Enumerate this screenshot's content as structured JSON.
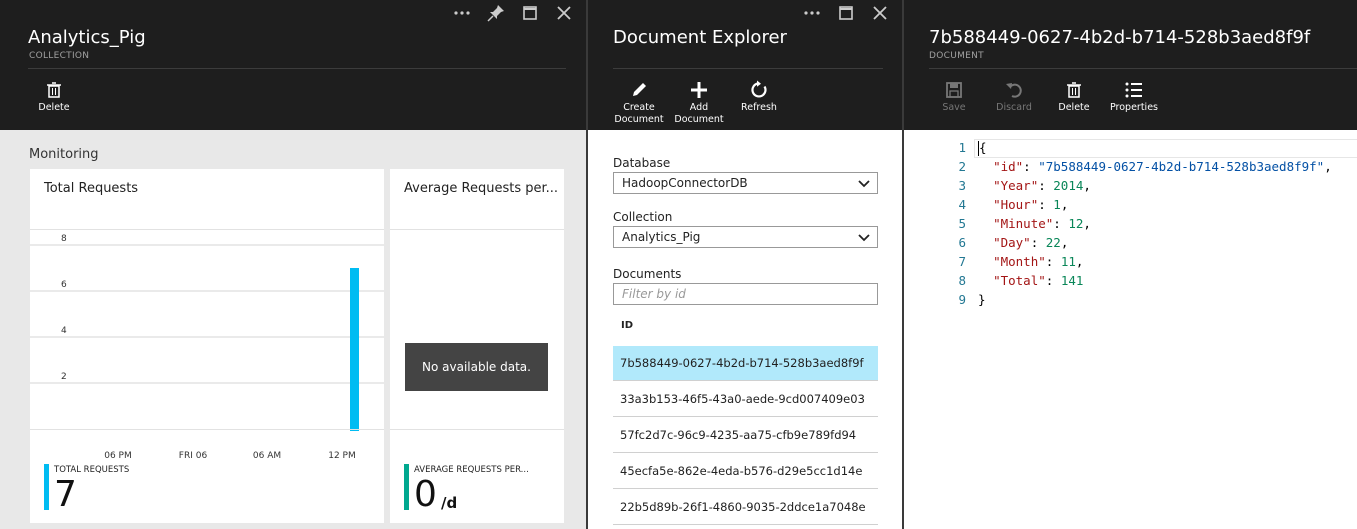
{
  "blade1": {
    "title": "Analytics_Pig",
    "subtitle": "COLLECTION",
    "commands": [
      {
        "label": "Delete",
        "icon": "trash-icon"
      }
    ],
    "section_title": "Monitoring",
    "tile_total": {
      "title": "Total Requests",
      "summary_label": "TOTAL REQUESTS",
      "summary_value": "7",
      "summary_color": "#00bcf2"
    },
    "tile_avg": {
      "title": "Average Requests per...",
      "no_data": "No available data.",
      "summary_label": "AVERAGE REQUESTS PER...",
      "summary_value": "0",
      "summary_unit": "/d",
      "summary_color": "#00a88f"
    }
  },
  "chart_data": {
    "type": "bar",
    "title": "Total Requests",
    "y_ticks": [
      "8",
      "6",
      "4",
      "2"
    ],
    "x_ticks": [
      "06 PM",
      "FRI 06",
      "06 AM",
      "12 PM"
    ],
    "ylim": [
      0,
      8
    ],
    "bars": [
      {
        "x": "12 PM",
        "value": 7
      }
    ],
    "bar_color": "#00bcf2",
    "grid": true
  },
  "blade2": {
    "title": "Document Explorer",
    "commands": [
      {
        "label": "Create Document",
        "icon": "pencil-icon"
      },
      {
        "label": "Add Document",
        "icon": "plus-icon"
      },
      {
        "label": "Refresh",
        "icon": "refresh-icon"
      }
    ],
    "database_label": "Database",
    "database_value": "HadoopConnectorDB",
    "collection_label": "Collection",
    "collection_value": "Analytics_Pig",
    "documents_label": "Documents",
    "filter_placeholder": "Filter by id",
    "id_header": "ID",
    "documents": [
      "7b588449-0627-4b2d-b714-528b3aed8f9f",
      "33a3b153-46f5-43a0-aede-9cd007409e03",
      "57fc2d7c-96c9-4235-aa75-cfb9e789fd94",
      "45ecfa5e-862e-4eda-b576-d29e5cc1d14e",
      "22b5d89b-26f1-4860-9035-2ddce1a7048e"
    ],
    "selected_index": 0
  },
  "blade3": {
    "title": "7b588449-0627-4b2d-b714-528b3aed8f9f",
    "subtitle": "DOCUMENT",
    "commands": [
      {
        "label": "Save",
        "icon": "save-icon",
        "disabled": true
      },
      {
        "label": "Discard",
        "icon": "undo-icon",
        "disabled": true
      },
      {
        "label": "Delete",
        "icon": "trash-icon",
        "disabled": false
      },
      {
        "label": "Properties",
        "icon": "list-icon",
        "disabled": false
      }
    ],
    "code_lines": [
      {
        "num": "1",
        "text": "{"
      },
      {
        "num": "2",
        "key": "\"id\"",
        "value": "\"7b588449-0627-4b2d-b714-528b3aed8f9f\"",
        "vtype": "s"
      },
      {
        "num": "3",
        "key": "\"Year\"",
        "value": "2014",
        "vtype": "n"
      },
      {
        "num": "4",
        "key": "\"Hour\"",
        "value": "1",
        "vtype": "n"
      },
      {
        "num": "5",
        "key": "\"Minute\"",
        "value": "12",
        "vtype": "n"
      },
      {
        "num": "6",
        "key": "\"Day\"",
        "value": "22",
        "vtype": "n"
      },
      {
        "num": "7",
        "key": "\"Month\"",
        "value": "11",
        "vtype": "n"
      },
      {
        "num": "8",
        "key": "\"Total\"",
        "value": "141",
        "vtype": "n",
        "last": true
      },
      {
        "num": "9",
        "text": "}"
      }
    ]
  }
}
